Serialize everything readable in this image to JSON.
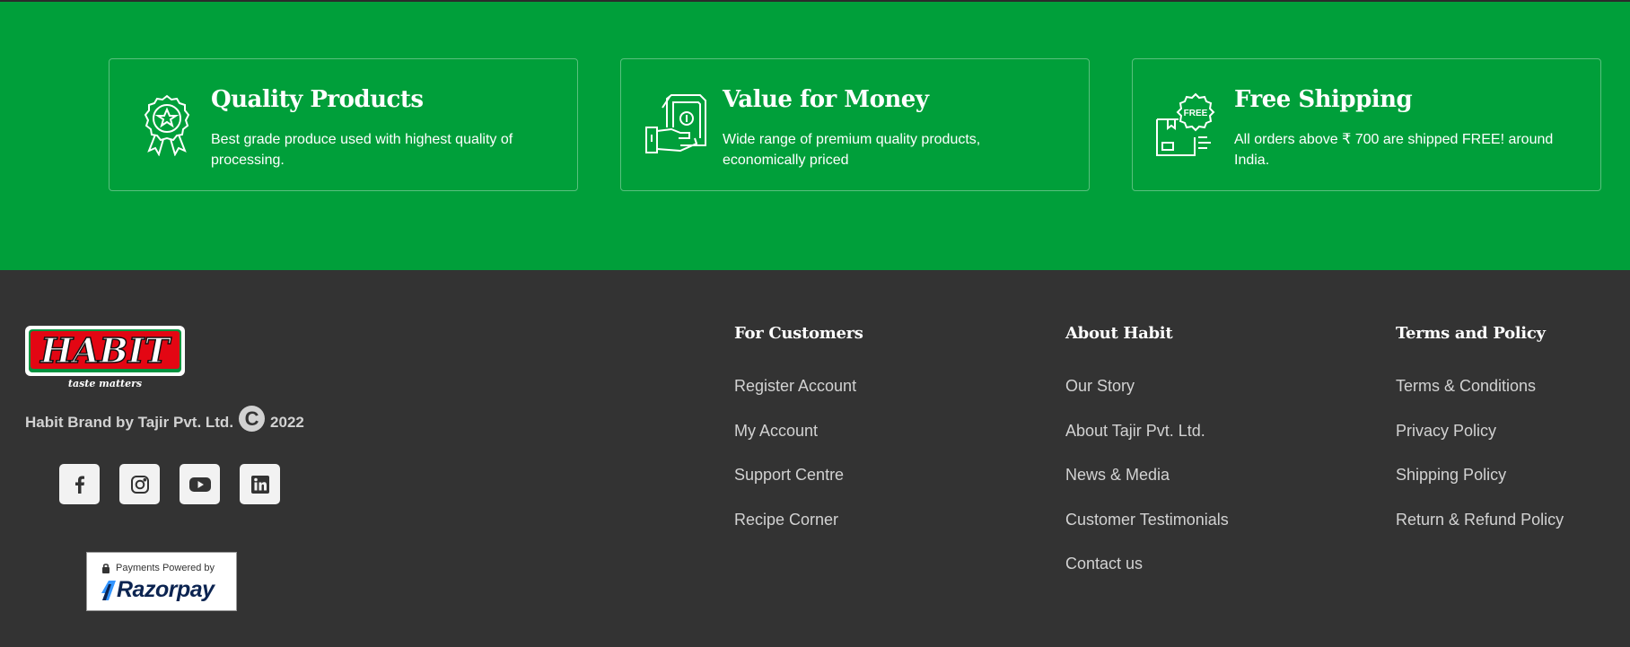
{
  "features": [
    {
      "title": "Quality Products",
      "description": "Best grade produce used with highest quality of processing.",
      "icon": "award-badge-icon"
    },
    {
      "title": "Value for Money",
      "description": "Wide range of premium quality products, economically priced",
      "icon": "cash-hand-icon"
    },
    {
      "title": "Free Shipping",
      "description": "All orders above ₹ 700 are shipped FREE! around India.",
      "icon": "free-shipping-box-icon",
      "badge_text": "FREE"
    }
  ],
  "logo": {
    "name": "HABIT",
    "tagline": "taste matters"
  },
  "brand": {
    "text": "Habit Brand by Tajir Pvt. Ltd.",
    "copyright_symbol": "C",
    "year": "2022"
  },
  "socials": [
    {
      "name": "facebook",
      "icon": "facebook-icon"
    },
    {
      "name": "instagram",
      "icon": "instagram-icon"
    },
    {
      "name": "youtube",
      "icon": "youtube-icon"
    },
    {
      "name": "linkedin",
      "icon": "linkedin-icon"
    }
  ],
  "payments": {
    "powered_by": "Payments Powered by",
    "provider": "Razorpay"
  },
  "columns": [
    {
      "heading": "For Customers",
      "links": [
        "Register Account",
        "My Account",
        "Support Centre",
        "Recipe Corner"
      ]
    },
    {
      "heading": "About Habit",
      "links": [
        "Our Story",
        "About Tajir Pvt. Ltd.",
        "News & Media",
        "Customer Testimonials",
        "Contact us"
      ]
    },
    {
      "heading": "Terms and Policy",
      "links": [
        "Terms & Conditions",
        "Privacy Policy",
        "Shipping Policy",
        "Return & Refund Policy"
      ]
    }
  ],
  "colors": {
    "green": "#009f3a",
    "footer_bg": "#333333",
    "logo_red": "#e30613",
    "logo_green": "#00923f"
  }
}
